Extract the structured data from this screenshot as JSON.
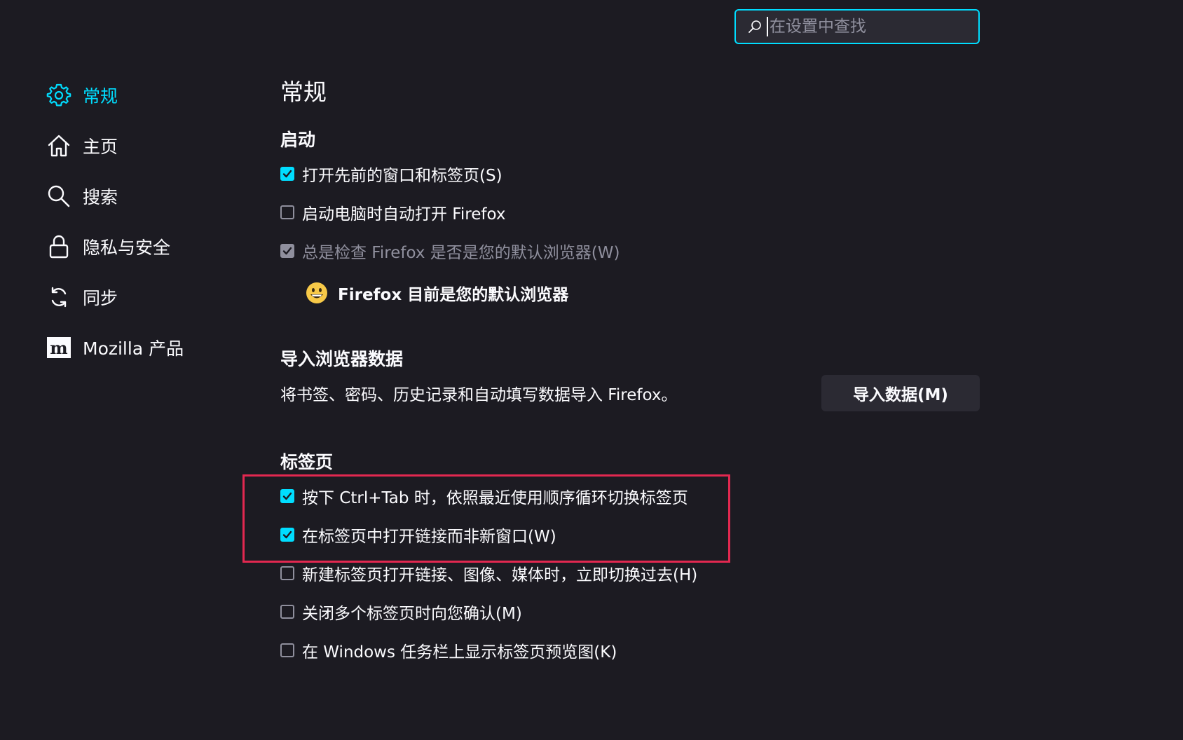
{
  "search": {
    "placeholder": "在设置中查找"
  },
  "sidebar": {
    "items": [
      {
        "label": "常规",
        "icon": "gear-icon",
        "active": true
      },
      {
        "label": "主页",
        "icon": "home-icon",
        "active": false
      },
      {
        "label": "搜索",
        "icon": "search-icon",
        "active": false
      },
      {
        "label": "隐私与安全",
        "icon": "lock-icon",
        "active": false
      },
      {
        "label": "同步",
        "icon": "sync-icon",
        "active": false
      },
      {
        "label": "Mozilla 产品",
        "icon": "mozilla-icon",
        "active": false
      }
    ]
  },
  "main": {
    "title": "常规",
    "startup": {
      "heading": "启动",
      "restore_session": {
        "label": "打开先前的窗口和标签页(S)",
        "checked": true
      },
      "autostart": {
        "label": "启动电脑时自动打开 Firefox",
        "checked": false
      },
      "check_default": {
        "label": "总是检查 Firefox 是否是您的默认浏览器(W)",
        "checked": true,
        "disabled": true
      },
      "default_message": "Firefox 目前是您的默认浏览器"
    },
    "import": {
      "heading": "导入浏览器数据",
      "description": "将书签、密码、历史记录和自动填写数据导入 Firefox。",
      "button_label": "导入数据(M)"
    },
    "tabs": {
      "heading": "标签页",
      "options": [
        {
          "label": "按下 Ctrl+Tab 时，依照最近使用顺序循环切换标签页",
          "checked": true
        },
        {
          "label": "在标签页中打开链接而非新窗口(W)",
          "checked": true
        },
        {
          "label": "新建标签页打开链接、图像、媒体时，立即切换过去(H)",
          "checked": false
        },
        {
          "label": "关闭多个标签页时向您确认(M)",
          "checked": false
        },
        {
          "label": "在 Windows 任务栏上显示标签页预览图(K)",
          "checked": false
        }
      ]
    }
  },
  "colors": {
    "background": "#1c1b22",
    "accent": "#00ddff",
    "highlight_border": "#e22850",
    "text": "#fbfbfe",
    "muted": "#8f8f9d"
  }
}
